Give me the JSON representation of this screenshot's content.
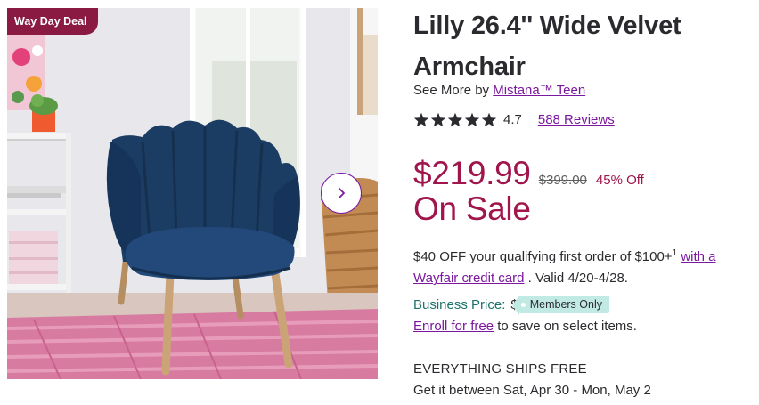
{
  "badge": {
    "label": "Way Day Deal"
  },
  "gallery": {
    "next_icon": "chevron-right-icon"
  },
  "product": {
    "title": "Lilly 26.4'' Wide Velvet Armchair",
    "brand_prefix": "See More by",
    "brand_name": "Mistana™ Teen",
    "rating_value": "4.7",
    "rating_stars": 5,
    "reviews_label": "588 Reviews"
  },
  "pricing": {
    "sale_price": "$219.99",
    "original_price": "$399.00",
    "discount": "45% Off",
    "on_sale_label": "On Sale"
  },
  "promo": {
    "text_start": "$40 OFF your qualifying first order of $100+",
    "footnote": "1",
    "link_text": "with a Wayfair credit card",
    "text_end": ". Valid 4/20-4/28."
  },
  "business": {
    "label": "Business Price:",
    "dollar": "$",
    "tag": "Members Only",
    "enroll_link": "Enroll for free",
    "enroll_text": "to save on select items."
  },
  "shipping": {
    "headline": "EVERYTHING SHIPS FREE",
    "delivery": "Get it between Sat, Apr 30 - Mon, May 2"
  },
  "colors": {
    "brand_purple": "#7b189f",
    "sale_red": "#a0154c",
    "badge_bg": "#8b1a43",
    "business_teal": "#1d7369",
    "members_tag_bg": "#c2eae5",
    "chair_navy": "#1b3d63"
  }
}
